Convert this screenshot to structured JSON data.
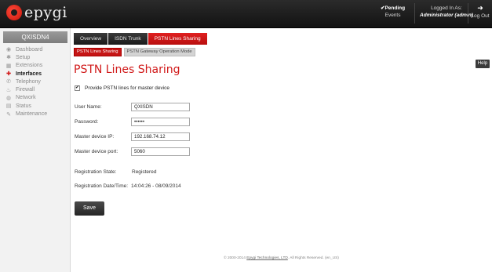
{
  "header": {
    "logo_text": "epygi",
    "pending_line1": "✔Pending",
    "pending_line2": "Events",
    "logged_line1": "Logged In As:",
    "logged_line2": "Administrator (admin)",
    "logout_label": "Log Out"
  },
  "sidebar": {
    "device_name": "QXISDN4",
    "items": [
      {
        "label": "Dashboard",
        "icon": "dashboard-icon",
        "glyph": "◉"
      },
      {
        "label": "Setup",
        "icon": "gear-icon",
        "glyph": "✱"
      },
      {
        "label": "Extensions",
        "icon": "extensions-icon",
        "glyph": "▦"
      },
      {
        "label": "Interfaces",
        "icon": "interfaces-icon",
        "glyph": "✚"
      },
      {
        "label": "Telephony",
        "icon": "phone-icon",
        "glyph": "✆"
      },
      {
        "label": "Firewall",
        "icon": "firewall-icon",
        "glyph": "♨"
      },
      {
        "label": "Network",
        "icon": "network-icon",
        "glyph": "◍"
      },
      {
        "label": "Status",
        "icon": "status-icon",
        "glyph": "▤"
      },
      {
        "label": "Maintenance",
        "icon": "wrench-icon",
        "glyph": "✎"
      }
    ],
    "active_index": 3
  },
  "tabs": [
    "Overview",
    "ISDN Trunk",
    "PSTN Lines Sharing"
  ],
  "subtabs": [
    "PSTN Lines Sharing",
    "PSTN Gateway Operation Mode"
  ],
  "help_label": "Help",
  "page_title": "PSTN Lines Sharing",
  "checkbox": {
    "label": "Provide PSTN lines for master device",
    "checked": true,
    "mark": "✔"
  },
  "form": {
    "username_label": "User Name:",
    "username_value": "QXISDN",
    "password_label": "Password:",
    "password_value": "••••••",
    "master_ip_label": "Master device IP:",
    "master_ip_value": "192.168.74.12",
    "master_port_label": "Master device port:",
    "master_port_value": "5060"
  },
  "registration": {
    "state_label": "Registration State:",
    "state_value": "Registered",
    "datetime_label": "Registration Date/Time:",
    "datetime_value": "14:04:26 - 08/09/2014"
  },
  "save_label": "Save",
  "footer": {
    "prefix": "© 2000-2014 ",
    "link": "Epygi Technologies, LTD",
    "suffix": ". All Rights Reserved. (en_US)"
  }
}
